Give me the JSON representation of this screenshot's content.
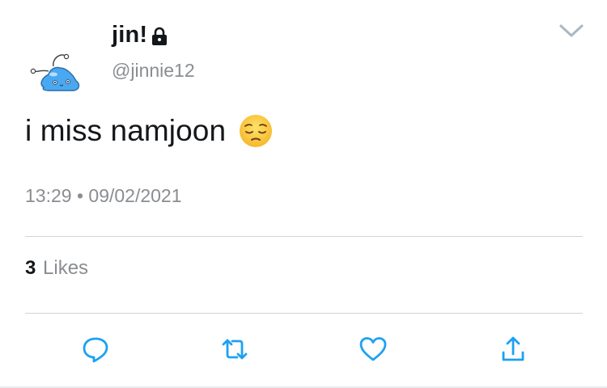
{
  "user": {
    "display_name": "jin!",
    "handle": "@jinnie12",
    "protected_icon": "lock-icon",
    "avatar_icon": "blue-slime-avatar"
  },
  "tweet": {
    "text": "i miss namjoon",
    "emoji": "pensive-face-emoji",
    "time": "13:29",
    "separator": "•",
    "date": "09/02/2021"
  },
  "stats": {
    "likes_count": "3",
    "likes_label": "Likes"
  },
  "actions": [
    {
      "name": "reply",
      "icon": "reply-icon"
    },
    {
      "name": "retweet",
      "icon": "retweet-icon"
    },
    {
      "name": "like",
      "icon": "heart-icon"
    },
    {
      "name": "share",
      "icon": "share-icon"
    }
  ],
  "colors": {
    "text_primary": "#14171a",
    "text_secondary": "#8a8d91",
    "icon_blue": "#1da1f2",
    "divider": "#cfd5da"
  }
}
